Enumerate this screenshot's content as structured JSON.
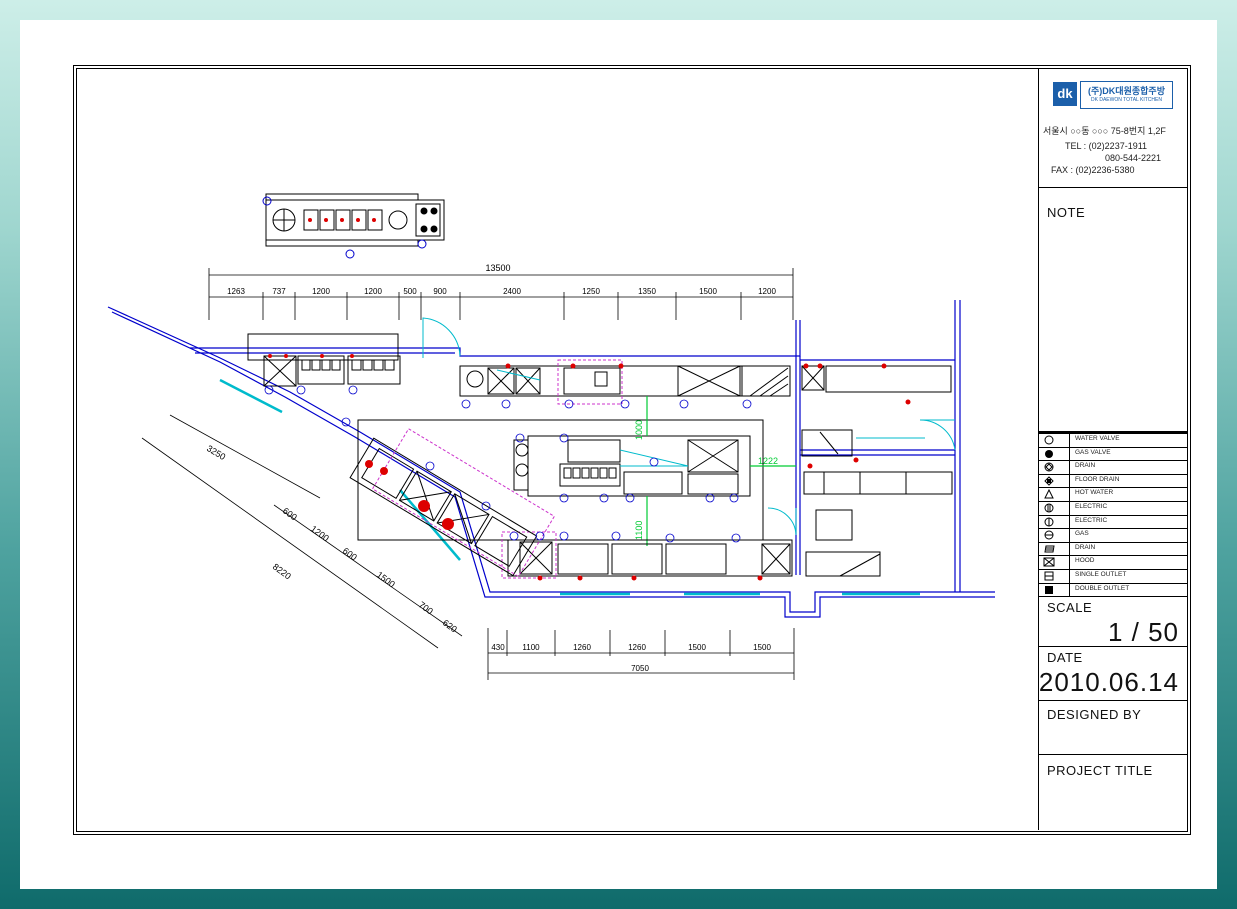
{
  "company": {
    "logo_mark": "dk",
    "name_ko": "(주)DK대원종합주방",
    "name_en": "DK DAEWON TOTAL KITCHEN",
    "address": "서울시 ○○동 ○○○ 75-8번지 1,2F",
    "tel_1": "TEL : (02)2237-1911",
    "tel_2": "080-544-2221",
    "fax": "FAX : (02)2236-5380"
  },
  "title_block": {
    "note_label": "NOTE",
    "scale_label": "SCALE",
    "scale_value": "1 / 50",
    "date_label": "DATE",
    "date_value": "2010.06.14",
    "designed_by_label": "DESIGNED BY",
    "project_title_label": "PROJECT TITLE"
  },
  "legend": [
    {
      "icon": "circle-icon",
      "label": "WATER VALVE"
    },
    {
      "icon": "hatched-circle-icon",
      "label": "GAS VALVE"
    },
    {
      "icon": "diamond-circle-icon",
      "label": "DRAIN"
    },
    {
      "icon": "diamond-square-icon",
      "label": "FLOOR DRAIN"
    },
    {
      "icon": "triangle-icon",
      "label": "HOT WATER"
    },
    {
      "icon": "circle-bar-icon",
      "label": "ELECTRIC"
    },
    {
      "icon": "circle-line-icon",
      "label": "ELECTRIC"
    },
    {
      "icon": "circle-wave-icon",
      "label": "GAS"
    },
    {
      "icon": "hatch-icon",
      "label": "DRAIN"
    },
    {
      "icon": "cross-box-icon",
      "label": "HOOD"
    },
    {
      "icon": "outlet-icon",
      "label": "SINGLE OUTLET"
    },
    {
      "icon": "filled-outlet-icon",
      "label": "DOUBLE OUTLET"
    }
  ],
  "dimensions": {
    "top_total": "13500",
    "top_segments": [
      "1263",
      "737",
      "1200",
      "1200",
      "500",
      "900",
      "2400",
      "1250",
      "1350",
      "1500",
      "1200"
    ],
    "bottom_total": "7050",
    "bottom_segments": [
      "430",
      "1100",
      "1260",
      "1260",
      "1500",
      "1500"
    ],
    "diag_total": "8220",
    "diag_top": "3250",
    "diag_segments": [
      "600",
      "1200",
      "600",
      "1500",
      "700",
      "620"
    ],
    "vertical_1": "1000",
    "vertical_2": "1100",
    "horizontal_1": "1222"
  },
  "colors": {
    "wall": "#0000cc",
    "window": "#00bbcc",
    "marker": "#dd0000",
    "dim_green": "#00cc33",
    "pink": "#cc33cc"
  }
}
